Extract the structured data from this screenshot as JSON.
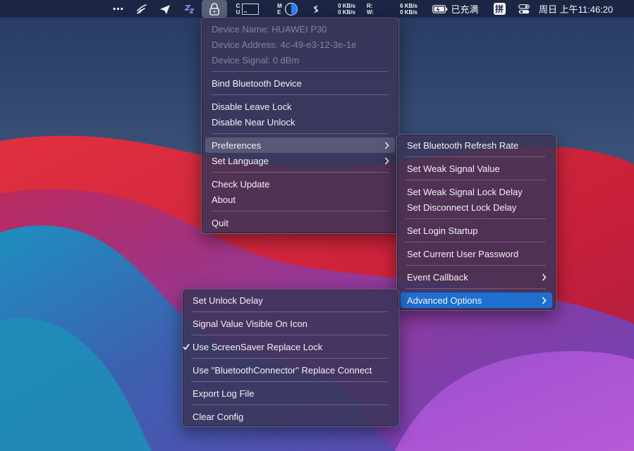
{
  "menubar": {
    "more_icon": "⋯",
    "net_up": "0 KB/s",
    "net_down": "0 KB/s",
    "disk_r_label": "R:",
    "disk_w_label": "W:",
    "disk_r": "6 KB/s",
    "disk_w": "0 KB/s",
    "cpu_label_1": "C",
    "cpu_label_2": "U",
    "mem_label_1": "M",
    "mem_label_2": "E",
    "battery_status": "已充满",
    "input_method": "拼",
    "clock": "周日 上午11:46:20"
  },
  "main_menu": {
    "device_name": "Device Name: HUAWEI P30",
    "device_address": "Device Address: 4c-49-e3-12-3e-1e",
    "device_signal": "Device Signal: 0 dBm",
    "bind": "Bind Bluetooth Device",
    "disable_leave_lock": "Disable Leave Lock",
    "disable_near_unlock": "Disable Near Unlock",
    "preferences": "Preferences",
    "set_language": "Set Language",
    "check_update": "Check Update",
    "about": "About",
    "quit": "Quit"
  },
  "preferences_menu": {
    "refresh_rate": "Set Bluetooth Refresh Rate",
    "weak_signal_value": "Set Weak Signal Value",
    "weak_signal_lock_delay": "Set Weak Signal Lock Delay",
    "disconnect_lock_delay": "Set Disconnect Lock Delay",
    "login_startup": "Set Login Startup",
    "current_user_password": "Set Current User Password",
    "event_callback": "Event Callback",
    "advanced_options": "Advanced Options"
  },
  "advanced_menu": {
    "unlock_delay": "Set Unlock Delay",
    "signal_visible": "Signal Value Visible On Icon",
    "screensaver_lock": "Use ScreenSaver Replace Lock",
    "bluetooth_connector": "Use \"BluetoothConnector\" Replace Connect",
    "export_log": "Export Log File",
    "clear_config": "Clear Config"
  },
  "icons": {
    "submenu": "chevron-right-icon",
    "check": "checkmark-icon"
  }
}
